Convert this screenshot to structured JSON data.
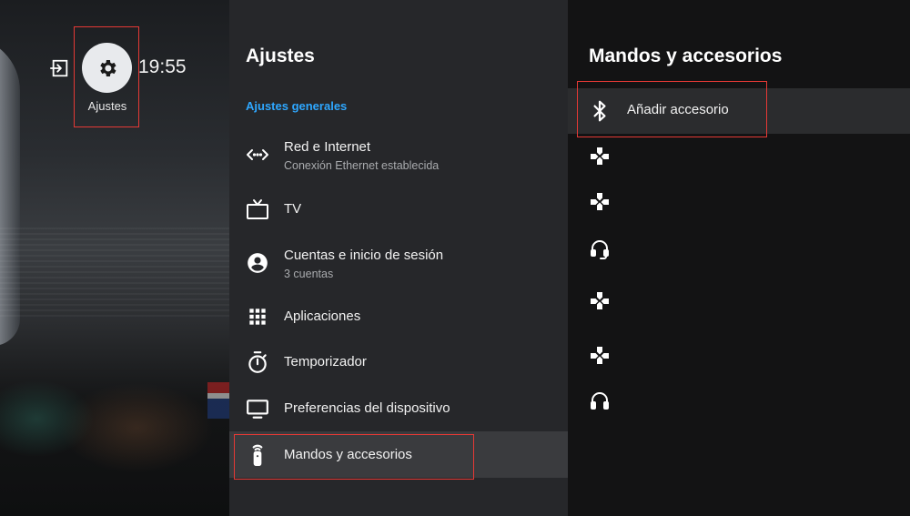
{
  "clock": "19:55",
  "top_shortcuts": {
    "input_icon": "input-icon",
    "settings_icon": "gear-icon",
    "settings_label": "Ajustes"
  },
  "settings_panel": {
    "title": "Ajustes",
    "section_title": "Ajustes generales",
    "items": [
      {
        "icon": "network-icon",
        "label": "Red e Internet",
        "sublabel": "Conexión Ethernet establecida"
      },
      {
        "icon": "tv-icon",
        "label": "TV",
        "sublabel": ""
      },
      {
        "icon": "account-icon",
        "label": "Cuentas e inicio de sesión",
        "sublabel": "3 cuentas"
      },
      {
        "icon": "apps-grid-icon",
        "label": "Aplicaciones",
        "sublabel": ""
      },
      {
        "icon": "timer-icon",
        "label": "Temporizador",
        "sublabel": ""
      },
      {
        "icon": "monitor-icon",
        "label": "Preferencias del dispositivo",
        "sublabel": ""
      },
      {
        "icon": "remote-icon",
        "label": "Mandos y accesorios",
        "sublabel": "",
        "selected": true
      }
    ]
  },
  "accessories_panel": {
    "title": "Mandos y accesorios",
    "items": [
      {
        "icon": "bluetooth-icon",
        "label": "Añadir accesorio",
        "selected": true
      },
      {
        "icon": "gamepad-icon",
        "label": ""
      },
      {
        "icon": "gamepad-icon",
        "label": ""
      },
      {
        "icon": "headset-icon",
        "label": ""
      },
      {
        "icon": "gamepad-icon",
        "label": ""
      },
      {
        "icon": "gamepad-icon",
        "label": ""
      },
      {
        "icon": "headphones-icon",
        "label": ""
      }
    ]
  },
  "colors": {
    "accent": "#2ea7ff",
    "highlight_box": "#e53935",
    "settings_panel_bg": "#26272a",
    "accessories_panel_bg": "#131314"
  }
}
